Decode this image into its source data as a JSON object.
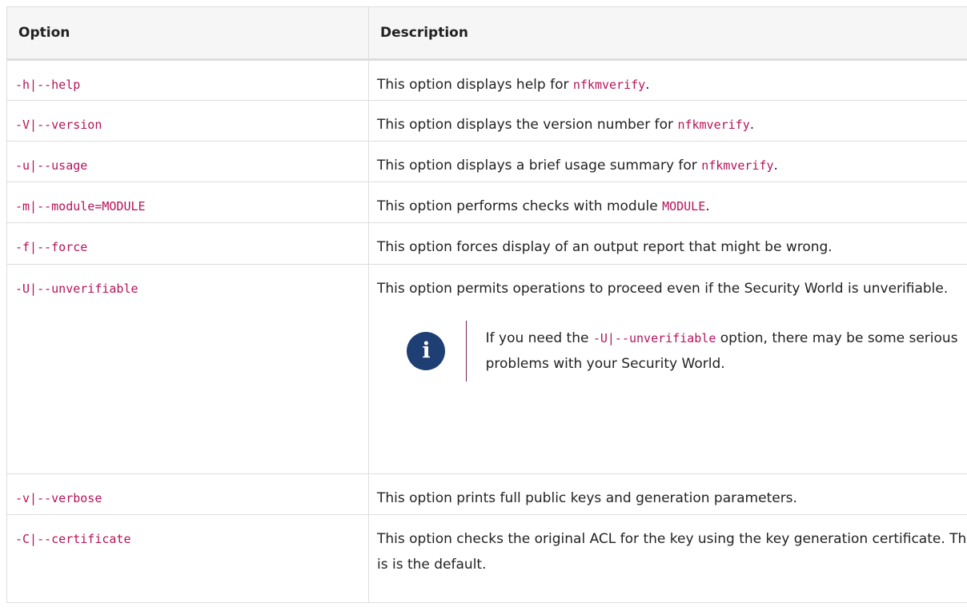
{
  "table": {
    "headers": {
      "option": "Option",
      "description": "Description"
    },
    "rows": [
      {
        "option": "-h|--help",
        "desc_pre": "This option displays help for ",
        "desc_code": "nfkmverify",
        "desc_post": "."
      },
      {
        "option": "-V|--version",
        "desc_pre": "This option displays the version number for ",
        "desc_code": "nfkmverify",
        "desc_post": "."
      },
      {
        "option": "-u|--usage",
        "desc_pre": "This option displays a brief usage summary for ",
        "desc_code": "nfkmverify",
        "desc_post": "."
      },
      {
        "option": "-m|--module=MODULE",
        "desc_pre": "This option performs checks with module ",
        "desc_code": "MODULE",
        "desc_post": "."
      },
      {
        "option": "-f|--force",
        "desc_pre": "This option forces display of an output report that might be wrong.",
        "desc_code": "",
        "desc_post": ""
      },
      {
        "option": "-U|--unverifiable",
        "desc_pre": "This option permits operations to proceed even if the Security World is unverifiable.",
        "desc_code": "",
        "desc_post": "",
        "note": {
          "icon": "info-icon",
          "icon_glyph": "i",
          "text_pre": "If you need the ",
          "text_code": "-U|--unverifiable",
          "text_post": " option, there may be some serious problems with your Security World."
        }
      },
      {
        "option": "-v|--verbose",
        "desc_pre": "This option prints full public keys and generation parameters.",
        "desc_code": "",
        "desc_post": ""
      },
      {
        "option": "-C|--certificate",
        "desc_pre": "This option checks the original ACL for the key using the key generation certificate. This is the default.",
        "desc_code": "",
        "desc_post": ""
      }
    ]
  }
}
